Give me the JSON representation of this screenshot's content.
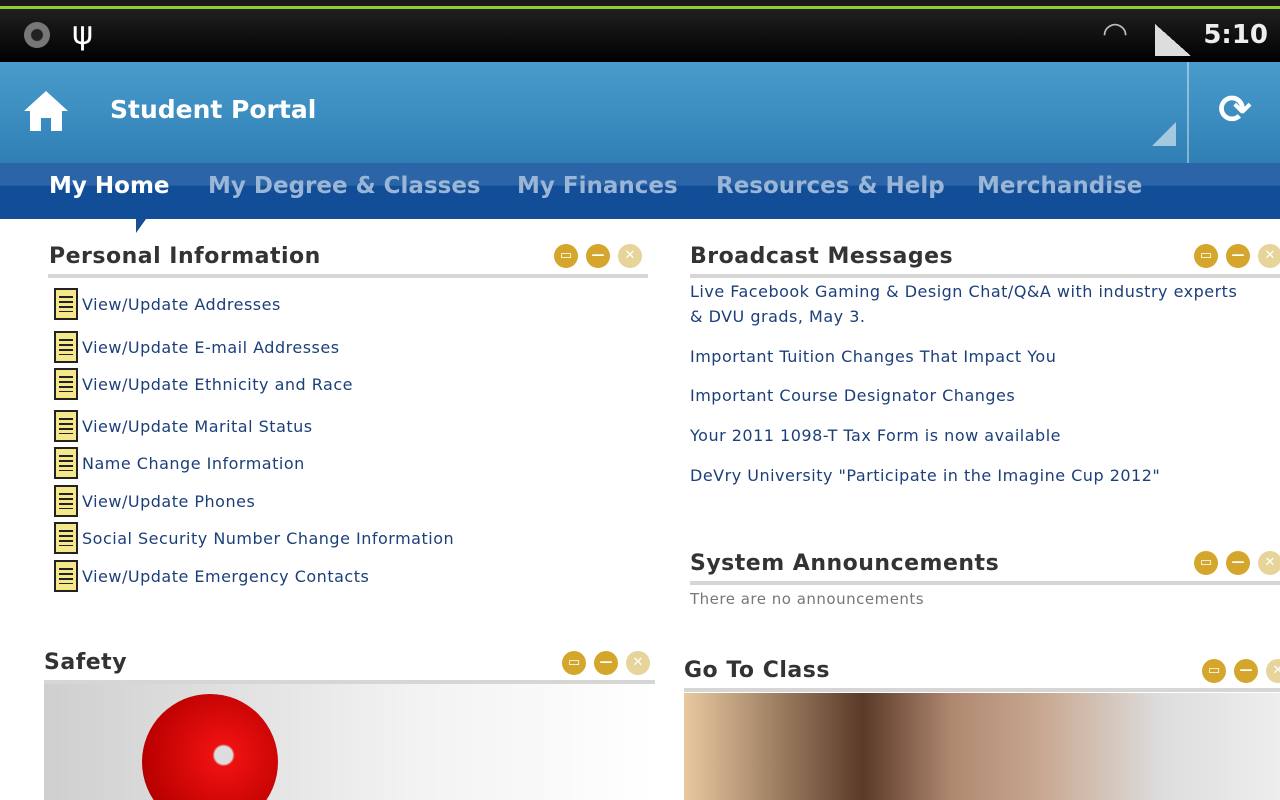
{
  "status_bar": {
    "time": "5:10",
    "icons": [
      "notification-icon",
      "usb-icon",
      "wifi-icon",
      "signal-icon"
    ]
  },
  "header": {
    "title": "Student Portal"
  },
  "nav": {
    "tabs": [
      "My Home",
      "My Degree & Classes",
      "My Finances",
      "Resources & Help",
      "Merchandise"
    ],
    "active": "My Home"
  },
  "personal": {
    "title": "Personal Information",
    "links": [
      "View/Update Addresses",
      "View/Update E-mail Addresses",
      "View/Update Ethnicity and Race",
      "View/Update Marital Status",
      "Name Change Information",
      "View/Update Phones",
      "Social Security Number Change Information",
      "View/Update Emergency Contacts"
    ]
  },
  "broadcast": {
    "title": "Broadcast Messages",
    "messages": [
      "Live Facebook Gaming & Design Chat/Q&A with industry experts",
      "& DVU grads, May 3.",
      "Important Tuition Changes That Impact You",
      "Important Course Designator Changes",
      "Your 2011 1098-T Tax Form is now available",
      "DeVry University \"Participate in the Imagine Cup 2012\""
    ]
  },
  "announcements": {
    "title": "System Announcements",
    "empty": "There are no announcements"
  },
  "safety": {
    "title": "Safety"
  },
  "go_to_class": {
    "title": "Go To Class"
  },
  "colors": {
    "accent": "#2f7fb5",
    "nav": "#124d97",
    "control": "#d4a72c"
  }
}
